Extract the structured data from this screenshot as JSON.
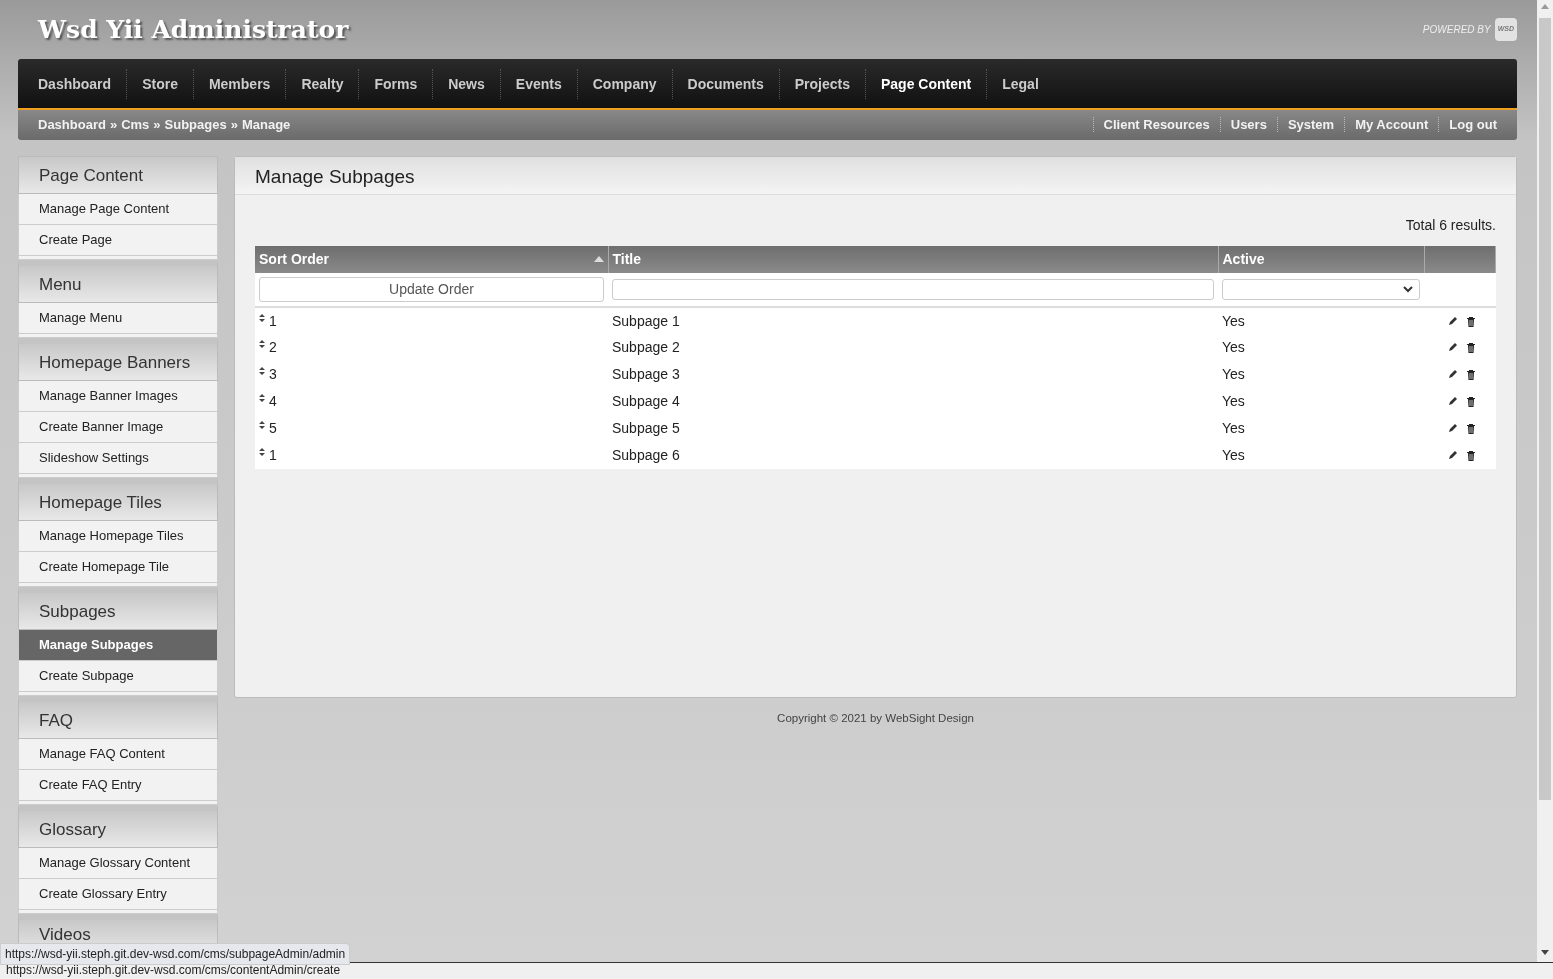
{
  "header": {
    "title": "Wsd Yii Administrator",
    "powered_by": "POWERED BY",
    "logo": "WSD"
  },
  "nav": [
    {
      "label": "Dashboard",
      "selected": false
    },
    {
      "label": "Store",
      "selected": false
    },
    {
      "label": "Members",
      "selected": false
    },
    {
      "label": "Realty",
      "selected": false
    },
    {
      "label": "Forms",
      "selected": false
    },
    {
      "label": "News",
      "selected": false
    },
    {
      "label": "Events",
      "selected": false
    },
    {
      "label": "Company",
      "selected": false
    },
    {
      "label": "Documents",
      "selected": false
    },
    {
      "label": "Projects",
      "selected": false
    },
    {
      "label": "Page Content",
      "selected": true
    },
    {
      "label": "Legal",
      "selected": false
    }
  ],
  "breadcrumbs": [
    "Dashboard",
    "Cms",
    "Subpages",
    "Manage"
  ],
  "breadcrumb_separator": "»",
  "user_menu": [
    "Client Resources",
    "Users",
    "System",
    "My Account",
    "Log out"
  ],
  "sidebar": [
    {
      "heading": "Page Content",
      "items": [
        {
          "label": "Manage Page Content",
          "selected": false
        },
        {
          "label": "Create Page",
          "selected": false
        }
      ]
    },
    {
      "heading": "Menu",
      "items": [
        {
          "label": "Manage Menu",
          "selected": false
        }
      ]
    },
    {
      "heading": "Homepage Banners",
      "items": [
        {
          "label": "Manage Banner Images",
          "selected": false
        },
        {
          "label": "Create Banner Image",
          "selected": false
        },
        {
          "label": "Slideshow Settings",
          "selected": false
        }
      ]
    },
    {
      "heading": "Homepage Tiles",
      "items": [
        {
          "label": "Manage Homepage Tiles",
          "selected": false
        },
        {
          "label": "Create Homepage Tile",
          "selected": false
        }
      ]
    },
    {
      "heading": "Subpages",
      "items": [
        {
          "label": "Manage Subpages",
          "selected": true
        },
        {
          "label": "Create Subpage",
          "selected": false
        }
      ]
    },
    {
      "heading": "FAQ",
      "items": [
        {
          "label": "Manage FAQ Content",
          "selected": false
        },
        {
          "label": "Create FAQ Entry",
          "selected": false
        }
      ]
    },
    {
      "heading": "Glossary",
      "items": [
        {
          "label": "Manage Glossary Content",
          "selected": false
        },
        {
          "label": "Create Glossary Entry",
          "selected": false
        }
      ]
    },
    {
      "heading": "Videos"
    }
  ],
  "main": {
    "title": "Manage Subpages",
    "summary": "Total 6 results.",
    "table": {
      "columns": [
        {
          "label": "Sort Order",
          "sorted": true
        },
        {
          "label": "Title"
        },
        {
          "label": "Active"
        },
        {}
      ],
      "filters": {
        "button": "Update Order"
      },
      "rows": [
        {
          "sort_order": "1",
          "title": "Subpage 1",
          "active": "Yes"
        },
        {
          "sort_order": "2",
          "title": "Subpage 2",
          "active": "Yes"
        },
        {
          "sort_order": "3",
          "title": "Subpage 3",
          "active": "Yes"
        },
        {
          "sort_order": "4",
          "title": "Subpage 4",
          "active": "Yes"
        },
        {
          "sort_order": "5",
          "title": "Subpage 5",
          "active": "Yes"
        },
        {
          "sort_order": "1",
          "title": "Subpage 6",
          "active": "Yes"
        }
      ]
    }
  },
  "footer": "Copyright © 2021 by WebSight Design",
  "status_urls": [
    "https://wsd-yii.steph.git.dev-wsd.com/cms/subpageAdmin/admin",
    "https://wsd-yii.steph.git.dev-wsd.com/cms/contentAdmin/create"
  ]
}
